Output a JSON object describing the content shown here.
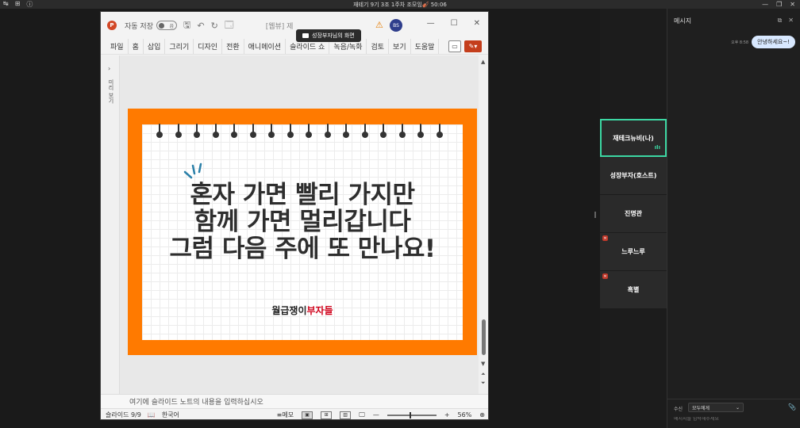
{
  "topbar": {
    "title": "재테기 9기 3조 1주차 조모임🎻 50:06",
    "left_icons": [
      "↹",
      "⊞",
      "ⓘ"
    ],
    "right_icons": [
      "—",
      "❐",
      "✕"
    ]
  },
  "ppt": {
    "logo": "P",
    "autosave_label": "자동 저장",
    "autosave_state": "끔",
    "filename": "[웹뷰] 제",
    "avatar": "BS",
    "share_banner": "성장부자님의 화면",
    "ribbon_tabs": [
      "파일",
      "홈",
      "삽입",
      "그리기",
      "디자인",
      "전환",
      "애니메이션",
      "슬라이드 쇼",
      "녹음/녹화",
      "검토",
      "보기",
      "도움말"
    ],
    "thumbs_label": "미리 보기",
    "slide": {
      "line1": "혼자 가면 빨리 가지만",
      "line2": "함께 가면 멀리갑니다",
      "line3": "그럼 다음 주에 또 만나요!",
      "brand_black": "월급쟁이",
      "brand_red": "부자들"
    },
    "notes_placeholder": "여기에 슬라이드 노트의 내용을 입력하십시오",
    "status": {
      "slide_count": "슬라이드 9/9",
      "language": "한국어",
      "memo": "메모",
      "zoom": "56%"
    }
  },
  "participants": [
    {
      "name": "재테크뉴비(나)",
      "active": true,
      "muted": false
    },
    {
      "name": "성장부자(호스트)",
      "active": false,
      "muted": false
    },
    {
      "name": "진명관",
      "active": false,
      "muted": false
    },
    {
      "name": "느루느루",
      "active": false,
      "muted": true
    },
    {
      "name": "흑별",
      "active": false,
      "muted": true
    }
  ],
  "chat": {
    "title": "메시지",
    "message_time": "오후 8:58",
    "message_text": "안녕하세요~!",
    "recipient_label": "수신",
    "recipient_value": "모두에게",
    "input_placeholder": "메시지를 입력해주세요"
  },
  "colors": {
    "slide_orange": "#ff7a00",
    "active_tile_border": "#3cd7a3",
    "ppt_red": "#c43e1c",
    "brand_red": "#d0021b"
  }
}
